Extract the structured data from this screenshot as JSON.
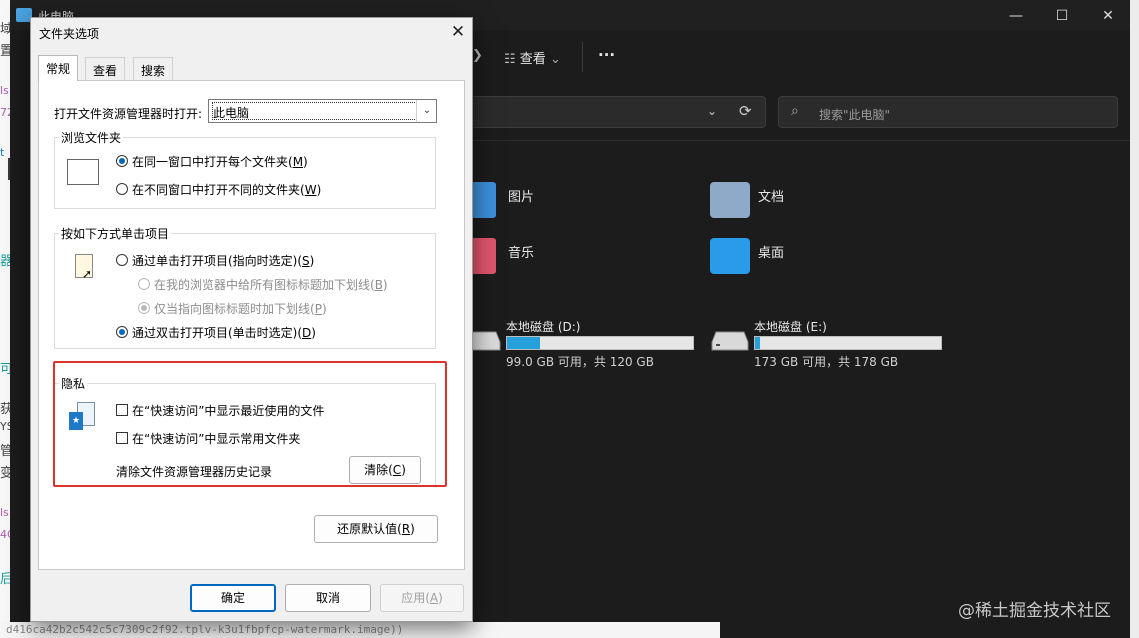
{
  "background": {
    "left_chars": [
      "域",
      "置",
      "ls",
      "72",
      "t",
      "器",
      "可",
      "获",
      "YS",
      "管",
      "变",
      "ls",
      "4C",
      "后",
      "9"
    ],
    "left_button": "∨",
    "bottom_code": "d416ca42b2c542c5c7309c2f92.tplv-k3u1fbpfcp-watermark.image))"
  },
  "explorer": {
    "title": "此电脑",
    "window_controls": [
      "—",
      "☐",
      "✕"
    ],
    "toolbar": {
      "view": "查看",
      "view_chevron": "⌄",
      "more": "···"
    },
    "address_chevron": "⌄",
    "refresh_icon": "⟳",
    "search_placeholder": "搜索\"此电脑\"",
    "search_icon": "⌕",
    "folders": [
      {
        "label": "图片",
        "icon": "pictures-folder-icon",
        "color": "#3b8fd9"
      },
      {
        "label": "文档",
        "icon": "documents-folder-icon",
        "color": "#8fa9c8"
      },
      {
        "label": "音乐",
        "icon": "music-folder-icon",
        "color": "#e0566b"
      },
      {
        "label": "桌面",
        "icon": "desktop-folder-icon",
        "color": "#2a9be8"
      }
    ],
    "drives": [
      {
        "name": "本地磁盘 (D:)",
        "free": "99.0 GB 可用，共 120 GB",
        "used_fraction": 0.175
      },
      {
        "name": "本地磁盘 (E:)",
        "free": "173 GB 可用，共 178 GB",
        "used_fraction": 0.028
      }
    ],
    "watermark": "@稀土掘金技术社区"
  },
  "dialog": {
    "title": "文件夹选项",
    "close": "✕",
    "tabs": [
      "常规",
      "查看",
      "搜索"
    ],
    "open_explorer_label": "打开文件资源管理器时打开:",
    "open_explorer_value": "此电脑",
    "combo_arrow": "⌄",
    "browse": {
      "label": "浏览文件夹",
      "opt1": "在同一窗口中打开每个文件夹(",
      "opt1_key": "M",
      "opt2": "在不同窗口中打开不同的文件夹(",
      "opt2_key": "W"
    },
    "click": {
      "label": "按如下方式单击项目",
      "single": "通过单击打开项目(指向时选定)(",
      "single_key": "S",
      "sub1": "在我的浏览器中给所有图标标题加下划线(",
      "sub1_key": "B",
      "sub2": "仅当指向图标标题时加下划线(",
      "sub2_key": "P",
      "double": "通过双击打开项目(单击时选定)(",
      "double_key": "D"
    },
    "privacy": {
      "label": "隐私",
      "recent": "在“快速访问”中显示最近使用的文件",
      "frequent": "在“快速访问”中显示常用文件夹",
      "clear_history": "清除文件资源管理器历史记录",
      "clear_btn": "清除(",
      "clear_key": "C"
    },
    "restore_btn": "还原默认值(",
    "restore_key": "R",
    "ok": "确定",
    "cancel": "取消",
    "apply": "应用(",
    "apply_key": "A",
    "close_paren": ")"
  }
}
